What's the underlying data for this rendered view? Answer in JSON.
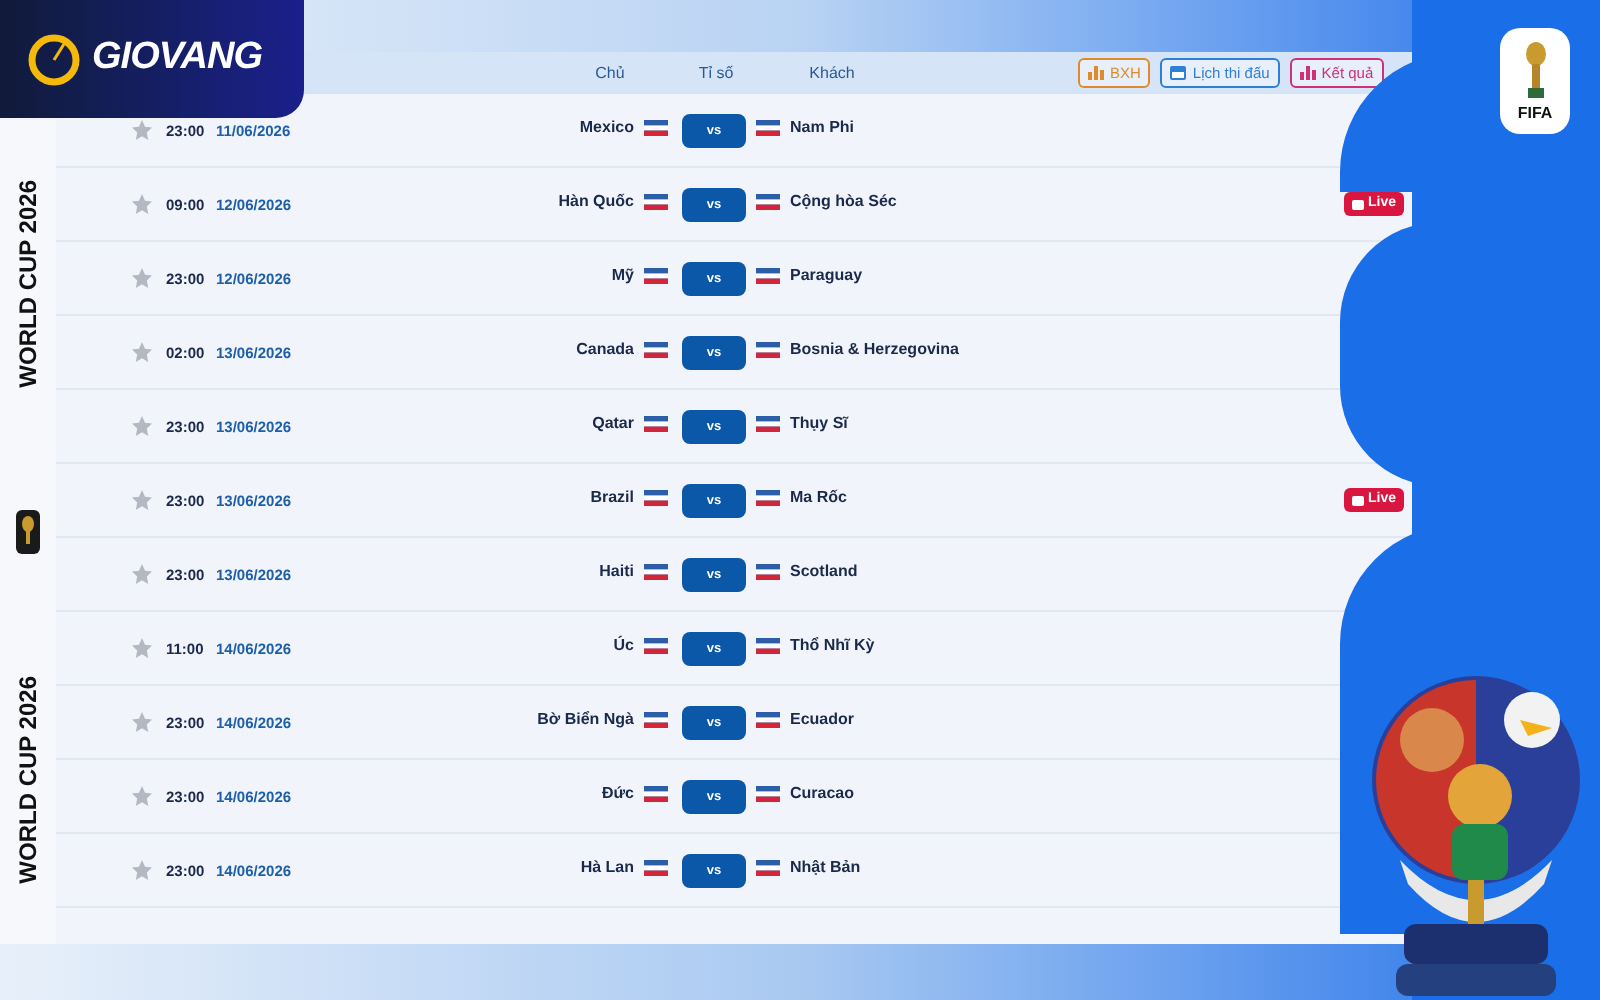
{
  "logo": {
    "text": "GIOVANG"
  },
  "side_labels": [
    "WORLD CUP 2026",
    "WORLD CUP 2026"
  ],
  "emblem": {
    "label": "FIFA"
  },
  "header": {
    "columns": [
      "Chủ",
      "Tỉ số",
      "Khách"
    ]
  },
  "header_buttons": [
    {
      "label": "BXH",
      "kind": "chart",
      "color": "#e08a2c"
    },
    {
      "label": "Lịch thi đấu",
      "kind": "calendar",
      "color": "#2f7fd6"
    },
    {
      "label": "Kết quả",
      "kind": "chart",
      "color": "#d0307a"
    }
  ],
  "rows": [
    {
      "time": "23:00",
      "date": "11/06/2026",
      "home": "Mexico",
      "score": "vs",
      "away": "Nam Phi"
    },
    {
      "time": "09:00",
      "date": "12/06/2026",
      "home": "Hàn Quốc",
      "score": "vs",
      "away": "Cộng hòa Séc",
      "badge": "Live"
    },
    {
      "time": "23:00",
      "date": "12/06/2026",
      "home": "Mỹ",
      "score": "vs",
      "away": "Paraguay"
    },
    {
      "time": "02:00",
      "date": "13/06/2026",
      "home": "Canada",
      "score": "vs",
      "away": "Bosnia & Herzegovina"
    },
    {
      "time": "23:00",
      "date": "13/06/2026",
      "home": "Qatar",
      "score": "vs",
      "away": "Thụy Sĩ"
    },
    {
      "time": "23:00",
      "date": "13/06/2026",
      "home": "Brazil",
      "score": "vs",
      "away": "Ma Rốc",
      "badge": "Live"
    },
    {
      "time": "23:00",
      "date": "13/06/2026",
      "home": "Haiti",
      "score": "vs",
      "away": "Scotland"
    },
    {
      "time": "11:00",
      "date": "14/06/2026",
      "home": "Úc",
      "score": "vs",
      "away": "Thổ Nhĩ Kỳ"
    },
    {
      "time": "23:00",
      "date": "14/06/2026",
      "home": "Bờ Biển Ngà",
      "score": "vs",
      "away": "Ecuador"
    },
    {
      "time": "23:00",
      "date": "14/06/2026",
      "home": "Đức",
      "score": "vs",
      "away": "Curacao"
    },
    {
      "time": "23:00",
      "date": "14/06/2026",
      "home": "Hà Lan",
      "score": "vs",
      "away": "Nhật Bản"
    }
  ]
}
